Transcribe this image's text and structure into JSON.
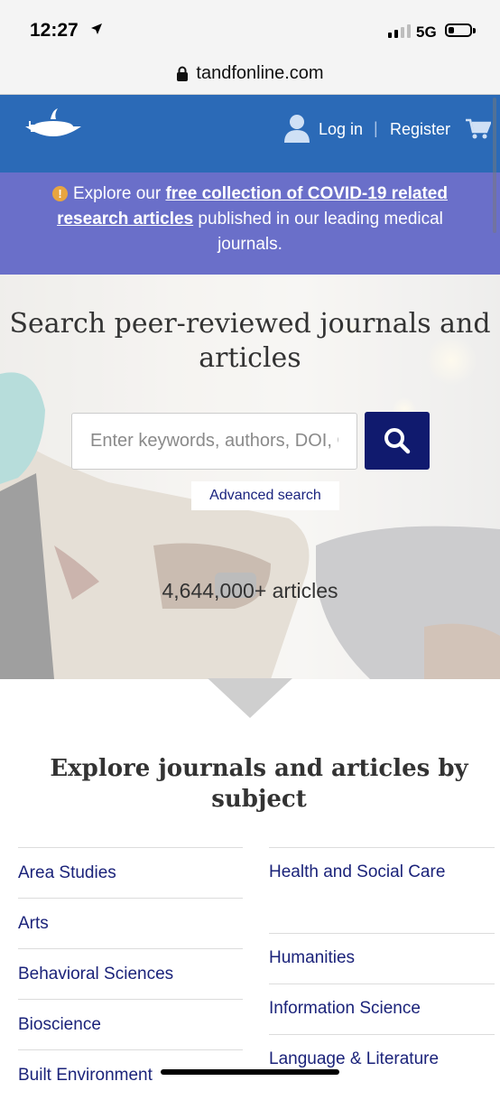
{
  "status_bar": {
    "time": "12:27",
    "network": "5G"
  },
  "browser": {
    "url": "tandfonline.com"
  },
  "header": {
    "login_label": "Log in",
    "separator": "|",
    "register_label": "Register"
  },
  "banner": {
    "text_before": "Explore our ",
    "link_text": "free collection of COVID-19 related research articles",
    "text_after": " published in our leading medical journals.",
    "icon": "!"
  },
  "hero": {
    "title": "Search peer-reviewed journals and articles",
    "search_placeholder": "Enter keywords, authors, DOI, ORCID etc",
    "advanced_label": "Advanced search",
    "article_count": "4,644,000+ articles"
  },
  "subjects": {
    "title": "Explore journals and articles by subject",
    "left": [
      "Area Studies",
      "Arts",
      "Behavioral Sciences",
      "Bioscience",
      "Built Environment"
    ],
    "right": [
      "Health and Social Care",
      "Humanities",
      "Information Science",
      "Language & Literature"
    ]
  },
  "colors": {
    "header": "#2b6ab7",
    "banner": "#6a6fc9",
    "search_button": "#101a6e",
    "link": "#1b237a"
  }
}
